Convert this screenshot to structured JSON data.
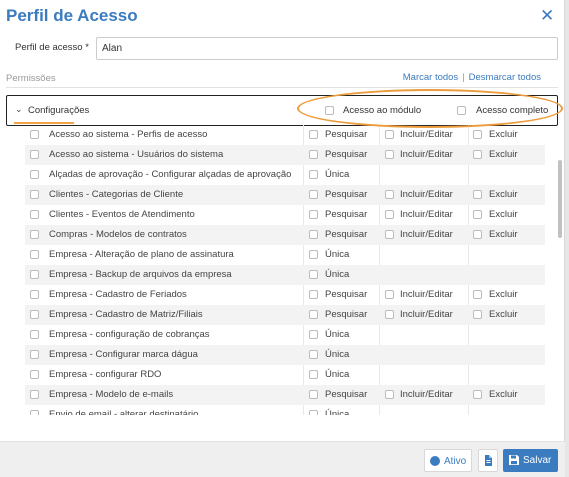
{
  "modal": {
    "title": "Perfil de Acesso",
    "close_icon": "close-icon"
  },
  "profile": {
    "label": "Perfil de acesso *",
    "value": "Alan"
  },
  "permissions": {
    "label": "Permissões",
    "mark_all": "Marcar todos",
    "separator": "|",
    "unmark_all": "Desmarcar todos"
  },
  "group": {
    "name": "Configurações",
    "module_access": "Acesso ao módulo",
    "full_access": "Acesso completo",
    "expanded": true
  },
  "labels": {
    "pesquisar": "Pesquisar",
    "incluir": "Incluir/Editar",
    "excluir": "Excluir",
    "unica": "Única"
  },
  "rows": [
    {
      "name": "Acesso ao sistema - Perfis de acesso",
      "type": "full"
    },
    {
      "name": "Acesso ao sistema - Usuários do sistema",
      "type": "full"
    },
    {
      "name": "Alçadas de aprovação - Configurar alçadas de aprovação",
      "type": "single"
    },
    {
      "name": "Clientes - Categorias de Cliente",
      "type": "full"
    },
    {
      "name": "Clientes - Eventos de Atendimento",
      "type": "full"
    },
    {
      "name": "Compras - Modelos de contratos",
      "type": "full"
    },
    {
      "name": "Empresa - Alteração de plano de assinatura",
      "type": "single"
    },
    {
      "name": "Empresa - Backup de arquivos da empresa",
      "type": "single"
    },
    {
      "name": "Empresa - Cadastro de Feriados",
      "type": "full"
    },
    {
      "name": "Empresa - Cadastro de Matriz/Filiais",
      "type": "full"
    },
    {
      "name": "Empresa - configuração de cobranças",
      "type": "single"
    },
    {
      "name": "Empresa - Configurar marca dágua",
      "type": "single"
    },
    {
      "name": "Empresa - configurar RDO",
      "type": "single"
    },
    {
      "name": "Empresa - Modelo de e-mails",
      "type": "full"
    },
    {
      "name": "Envio de email - alterar destinatário",
      "type": "single"
    }
  ],
  "footer": {
    "active_label": "Ativo",
    "save_label": "Salvar"
  },
  "colors": {
    "accent": "#3b7bbf",
    "highlight_oval": "#ec9c3c",
    "underline": "#f0a445"
  }
}
